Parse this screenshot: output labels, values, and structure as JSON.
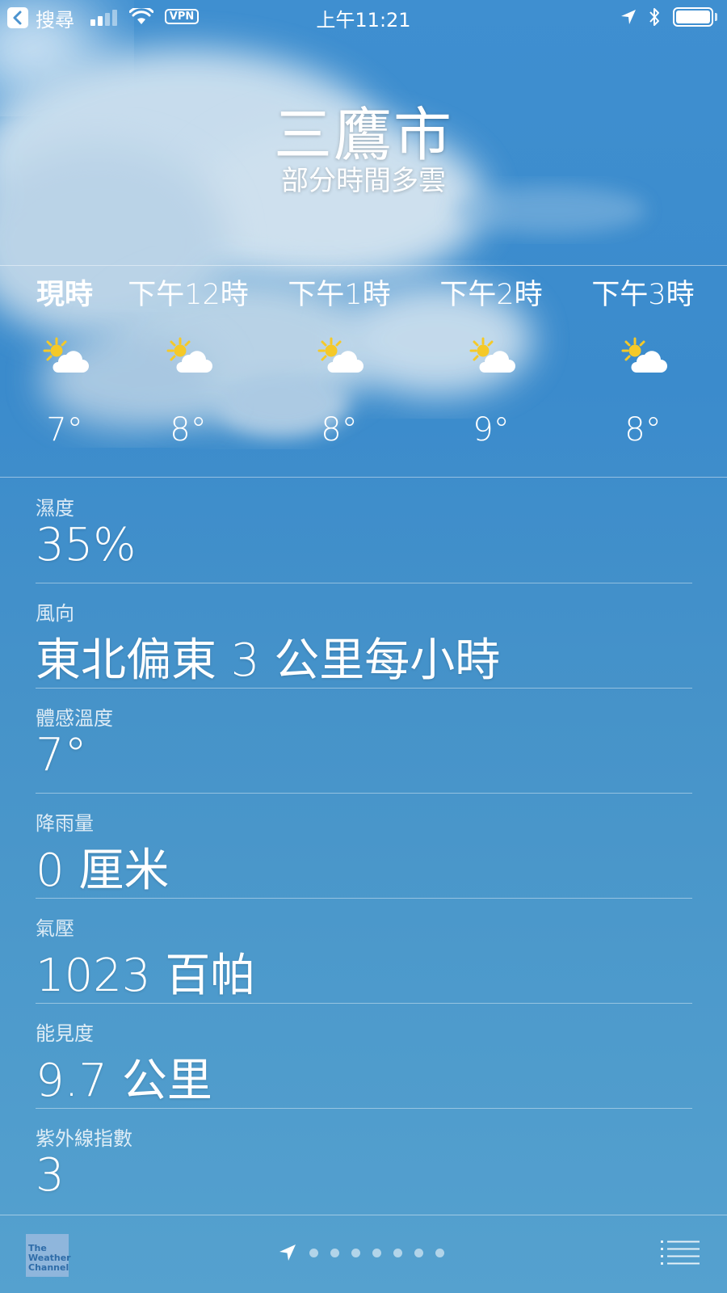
{
  "status_bar": {
    "back_label": "搜尋",
    "vpn": "VPN",
    "time": "上午11:21"
  },
  "location": {
    "city": "三鷹市",
    "condition": "部分時間多雲"
  },
  "hourly": [
    {
      "label": "現時",
      "temp": "7°",
      "icon": "partly-cloudy-icon"
    },
    {
      "label": "下午12時",
      "temp": "8°",
      "icon": "partly-cloudy-icon"
    },
    {
      "label": "下午1時",
      "temp": "8°",
      "icon": "partly-cloudy-icon"
    },
    {
      "label": "下午2時",
      "temp": "9°",
      "icon": "partly-cloudy-icon"
    },
    {
      "label": "下午3時",
      "temp": "8°",
      "icon": "partly-cloudy-icon"
    }
  ],
  "details": [
    {
      "label": "濕度",
      "value": "35%"
    },
    {
      "label": "風向",
      "value": "東北偏東 3 公里每小時"
    },
    {
      "label": "體感溫度",
      "value": "7°"
    },
    {
      "label": "降雨量",
      "value": "0 厘米"
    },
    {
      "label": "氣壓",
      "value": "1023 百帕"
    },
    {
      "label": "能見度",
      "value": "9.7 公里"
    },
    {
      "label": "紫外線指數",
      "value": "3"
    }
  ],
  "footer": {
    "logo_text": [
      "The",
      "Weather",
      "Channel"
    ],
    "page_count": 7,
    "icons": [
      "location-arrow-icon",
      "list-icon"
    ]
  },
  "colors": {
    "sky": "#3f8fd0",
    "sun": "#f5c928",
    "cloud": "#ffffff"
  }
}
